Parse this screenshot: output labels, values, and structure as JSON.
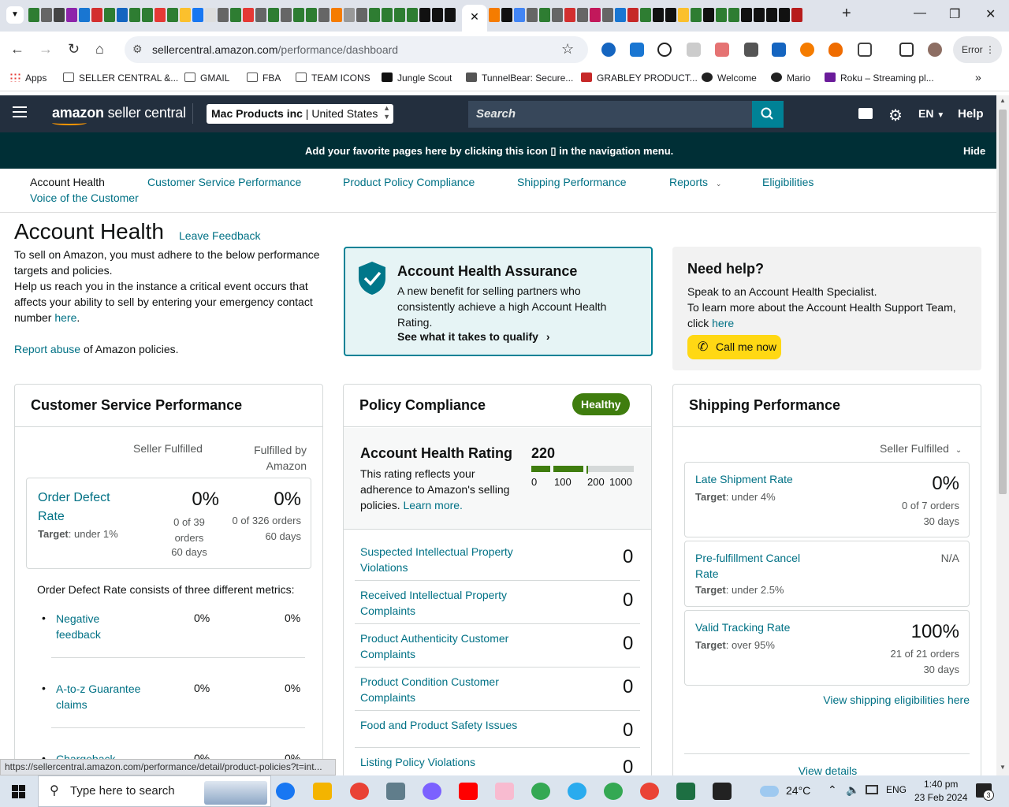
{
  "browser": {
    "active_tab_close": "✕",
    "window_controls": [
      "—",
      "❐",
      "✕"
    ],
    "url_domain": "sellercentral.amazon.com",
    "url_path": "/performance/dashboard",
    "error_label": "Error",
    "bookmarks": [
      "Apps",
      "SELLER CENTRAL &...",
      "GMAIL",
      "FBA",
      "TEAM ICONS",
      "Jungle Scout",
      "TunnelBear: Secure...",
      "GRABLEY PRODUCT...",
      "Welcome",
      "Mario",
      "Roku – Streaming pl..."
    ],
    "status_url": "https://sellercentral.amazon.com/performance/detail/product-policies?t=int..."
  },
  "header": {
    "logo_brand": "amazon",
    "logo_suffix": " seller central",
    "account_name": "Mac Products inc",
    "account_region": " | United States",
    "search_placeholder": "Search",
    "language": "EN",
    "help": "Help"
  },
  "banner": {
    "message": "Add your favorite pages here by clicking this icon ▯ in the navigation menu.",
    "hide": "Hide"
  },
  "subnav": {
    "items": [
      "Account Health",
      "Customer Service Performance",
      "Product Policy Compliance",
      "Shipping Performance",
      "Reports",
      "Eligibilities",
      "Voice of the Customer"
    ]
  },
  "page": {
    "title": "Account Health",
    "leave_feedback": "Leave Feedback",
    "intro1": "To sell on Amazon, you must adhere to the below performance targets and policies.",
    "intro2_a": "Help us reach you in the instance a critical event occurs that affects your ability to sell by entering your emergency contact number ",
    "intro2_link": "here",
    "intro2_b": ".",
    "report_link": "Report abuse",
    "report_rest": " of Amazon policies."
  },
  "aha": {
    "title": "Account Health Assurance",
    "text": "A new benefit for selling partners who consistently achieve a high Account Health Rating.",
    "cta": "See what it takes to qualify"
  },
  "need_help": {
    "title": "Need help?",
    "line1": "Speak to an Account Health Specialist.",
    "line2": "To learn more about the Account Health Support Team, click ",
    "line2_link": "here",
    "call_button": "Call me now"
  },
  "customer_service": {
    "title": "Customer Service Performance",
    "col1": "Seller Fulfilled",
    "col2": "Fulfilled by Amazon",
    "odr_label": "Order Defect Rate",
    "odr_target_label": "Target",
    "odr_target": ": under 1%",
    "odr_sf_value": "0%",
    "odr_sf_detail": "0 of 39 orders",
    "odr_sf_days": "60 days",
    "odr_fba_value": "0%",
    "odr_fba_detail": "0 of 326 orders",
    "odr_fba_days": "60 days",
    "consists": "Order Defect Rate consists of three different metrics:",
    "metrics": [
      {
        "label": "Negative feedback",
        "sf": "0%",
        "fba": "0%"
      },
      {
        "label": "A-to-z Guarantee claims",
        "sf": "0%",
        "fba": "0%"
      },
      {
        "label": "Chargeback",
        "sf": "0%",
        "fba": "0%"
      }
    ]
  },
  "policy": {
    "title": "Policy Compliance",
    "status": "Healthy",
    "ahr_title": "Account Health Rating",
    "ahr_value": "220",
    "ahr_desc": "This rating reflects your adherence to Amazon's selling policies. ",
    "ahr_learn": "Learn more.",
    "scale": [
      "0",
      "100",
      "200",
      "1000"
    ],
    "rating_fraction": 0.22,
    "rows": [
      {
        "label": "Suspected Intellectual Property Violations",
        "count": "0"
      },
      {
        "label": "Received Intellectual Property Complaints",
        "count": "0"
      },
      {
        "label": "Product Authenticity Customer Complaints",
        "count": "0"
      },
      {
        "label": "Product Condition Customer Complaints",
        "count": "0"
      },
      {
        "label": "Food and Product Safety Issues",
        "count": "0"
      },
      {
        "label": "Listing Policy Violations",
        "count": "0"
      }
    ]
  },
  "shipping": {
    "title": "Shipping Performance",
    "filter": "Seller Fulfilled",
    "late_label": "Late Shipment Rate",
    "late_target_label": "Target",
    "late_target": ": under 4%",
    "late_value": "0%",
    "late_detail": "0 of 7 orders",
    "late_days": "30 days",
    "cancel_label": "Pre-fulfillment Cancel Rate",
    "cancel_target_label": "Target",
    "cancel_target": ": under 2.5%",
    "cancel_value": "N/A",
    "vtr_label": "Valid Tracking Rate",
    "vtr_target_label": "Target",
    "vtr_target": ": over 95%",
    "vtr_value": "100%",
    "vtr_detail": "21 of 21 orders",
    "vtr_days": "30 days",
    "eligibilities": "View shipping eligibilities here",
    "view_details": "View details"
  },
  "taskbar": {
    "search_placeholder": "Type here to search",
    "weather": "24°C",
    "lang": "ENG",
    "time": "1:40 pm",
    "date": "23 Feb 2024",
    "notif_count": "3"
  }
}
